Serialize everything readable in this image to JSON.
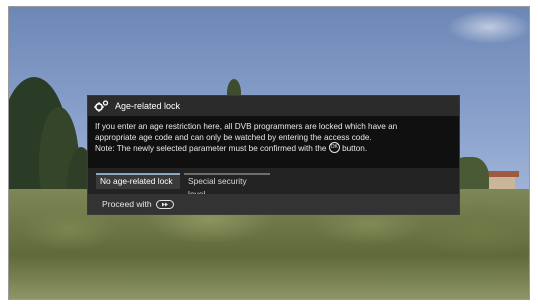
{
  "dialog": {
    "title": "Age-related lock",
    "title_icon": "gears-icon",
    "paragraph": {
      "line1": "If you enter an age restriction here, all DVB programmers are locked which have an",
      "line2": "appropriate age code and can only be watched by entering the access code.",
      "line3_before": "Note: The newly selected parameter must be confirmed with the",
      "ok_icon_text": "OK",
      "line3_after": "button."
    },
    "options": [
      {
        "label": "No age-related lock",
        "selected": true
      },
      {
        "label": "Special security level",
        "selected": false
      }
    ],
    "footer": {
      "proceed_label": "Proceed with",
      "proceed_icon": "remote-forward-button-icon"
    }
  },
  "colors": {
    "selected_accent": "#8fa8c2",
    "dialog_bg": "#1c1c1c"
  }
}
